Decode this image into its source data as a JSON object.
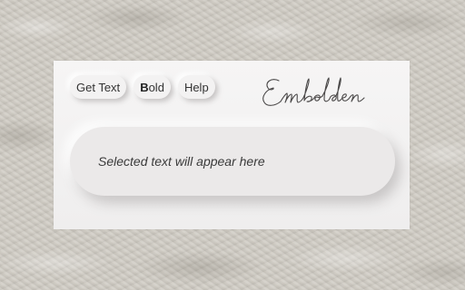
{
  "toolbar": {
    "get_text_label": "Get Text",
    "bold_label_first": "B",
    "bold_label_rest": "old",
    "help_label": "Help"
  },
  "brand": {
    "name": "Embolden"
  },
  "output": {
    "placeholder": "Selected text will appear here"
  },
  "colors": {
    "panel": "#f3f2f2",
    "text": "#333333",
    "wall": "#cfcbc3"
  }
}
